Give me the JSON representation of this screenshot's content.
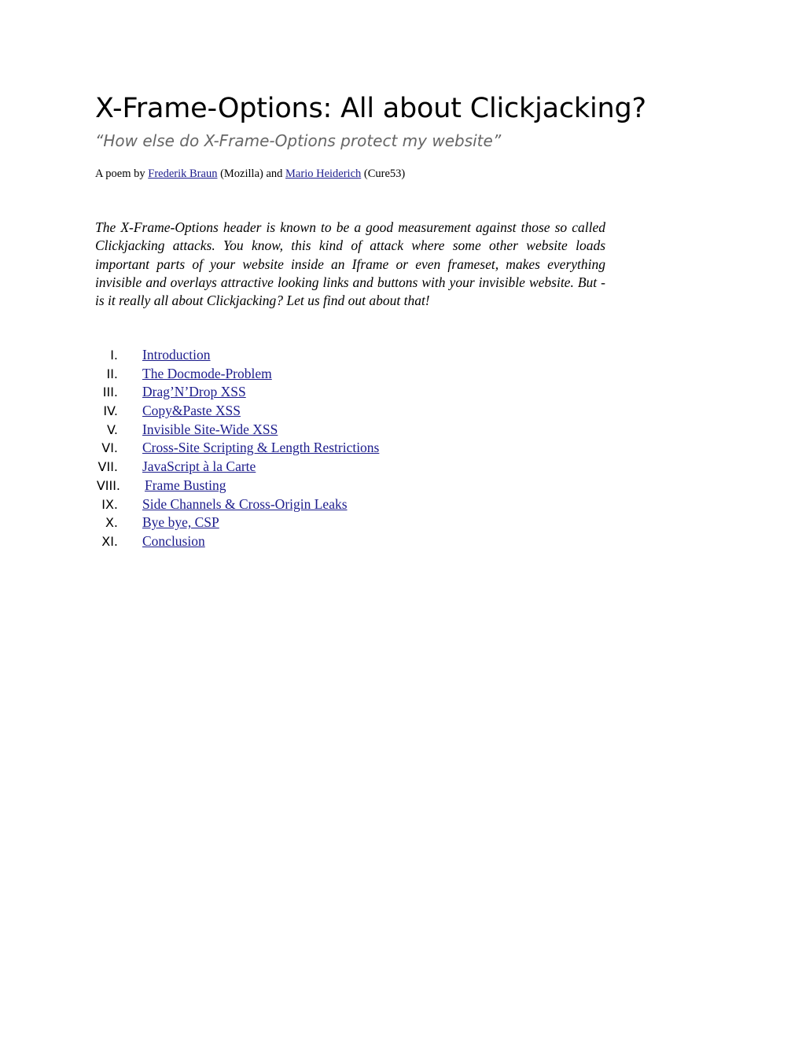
{
  "document": {
    "title": "X-Frame-Options: All about Clickjacking?",
    "subtitle": "“How else do X-Frame-Options protect my website”",
    "byline": {
      "prefix": "A poem by ",
      "author1": "Frederik Braun",
      "author1_org": " (Mozilla) and ",
      "author2": "Mario Heiderich",
      "author2_org": " (Cure53)"
    },
    "intro": "The X-Frame-Options header is known to be a good measurement against those so called Clickjacking attacks. You know, this kind of attack where some other website loads important parts of your website inside an Iframe or even frameset, makes everything invisible and overlays attractive looking links and buttons with your invisible website. But - is it really all about Clickjacking? Let us find out about that!",
    "toc": [
      {
        "num": "I.",
        "label": "Introduction"
      },
      {
        "num": "II.",
        "label": "The Docmode-Problem"
      },
      {
        "num": "III.",
        "label": "Drag’N’Drop XSS"
      },
      {
        "num": "IV.",
        "label": "Copy&Paste XSS"
      },
      {
        "num": "V.",
        "label": "Invisible Site-Wide XSS"
      },
      {
        "num": "VI.",
        "label": "Cross-Site Scripting & Length Restrictions"
      },
      {
        "num": "VII.",
        "label": "JavaScript à la Carte"
      },
      {
        "num": "VIII.",
        "label": "Frame Busting"
      },
      {
        "num": "IX.",
        "label": "Side Channels & Cross-Origin Leaks"
      },
      {
        "num": "X.",
        "label": "Bye bye, CSP"
      },
      {
        "num": "XI.",
        "label": "Conclusion"
      }
    ]
  },
  "colors": {
    "link": "#1c1c8c",
    "subtitle": "#666666",
    "text": "#000000"
  }
}
